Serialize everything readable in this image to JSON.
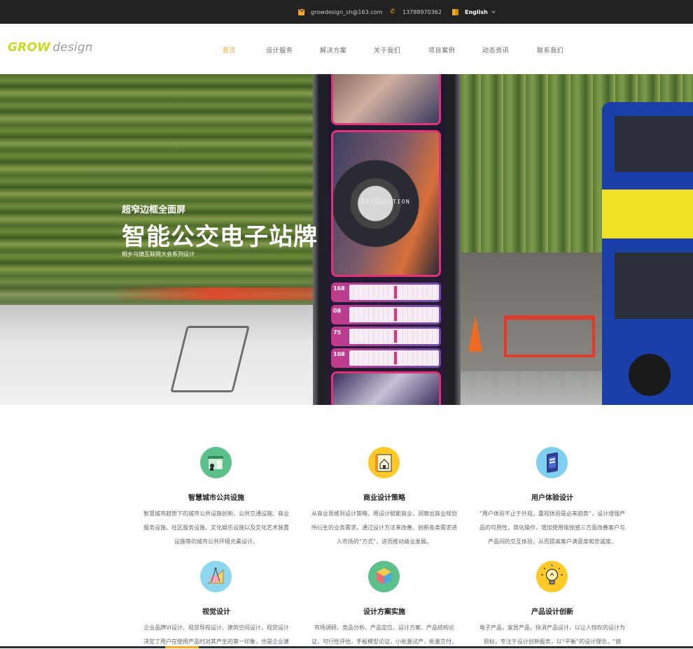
{
  "topbar": {
    "email": "growdesign_sh@163.com",
    "phone": "13788970362",
    "language": "English"
  },
  "header": {
    "logo_grow": "GROW",
    "logo_design": "design",
    "nav": [
      {
        "label": "首页",
        "active": true
      },
      {
        "label": "设计服务",
        "active": false
      },
      {
        "label": "解决方案",
        "active": false
      },
      {
        "label": "关于我们",
        "active": false
      },
      {
        "label": "项目案例",
        "active": false
      },
      {
        "label": "动态资讯",
        "active": false
      },
      {
        "label": "联系我们",
        "active": false
      }
    ]
  },
  "hero": {
    "subtitle": "超窄边框全面屏",
    "title": "智能公交电子站牌",
    "caption": "桐乡乌镇互联网大会系列设计",
    "poster_title": "DISSOLUTION",
    "routes": [
      "168",
      "08",
      "75",
      "108"
    ]
  },
  "services": [
    {
      "icon": "city-kiosk-icon",
      "icon_color": "#5cc08a",
      "title": "智慧城市公共设施",
      "lines": [
        "智慧城市趋势下的城市公共设施创新，公共交通设施、商业",
        "服务设施、社区服务设施、文化娱乐设施以及文化艺术装置",
        "设施等的城市公共环境元素设计。"
      ]
    },
    {
      "icon": "blueprint-house-icon",
      "icon_color": "#ffc928",
      "title": "商业设计策略",
      "lines": [
        "从商业思维到设计策略，用设计赋能商业，洞察出商业规划",
        "所衍生的业务需求，通过设计方法来改善、创新各类需求进",
        "入市场的“方式”，进而推动商业发展。"
      ]
    },
    {
      "icon": "mobile-device-icon",
      "icon_color": "#7fd0f0",
      "title": "用户体验设计",
      "lines": [
        "“用户体验不止于外观，重视体验是必来趋势”，设计增强产",
        "品的可用性，简化操作，增加使用愉悦感三方面改善客户与",
        "产品间的交互体验，从而提高客户满意度和忠诚度。"
      ]
    },
    {
      "icon": "compass-ruler-icon",
      "icon_color": "#8ed6f0",
      "title": "视觉设计",
      "lines": [
        "企业品牌VI设计、视觉导视设计、建筑空间设计，视觉设计",
        "决定了用户在使用产品时对其产生的第一印象，也是企业建"
      ]
    },
    {
      "icon": "cube-icon",
      "icon_color": "#5cc08a",
      "title": "设计方案实施",
      "lines": [
        "市场调研、竞品分析、产品定位、设计方案、产品结构论",
        "证，可行性评估，手板模型论证，小批量试产，批量交付，"
      ]
    },
    {
      "icon": "lightbulb-icon",
      "icon_color": "#ffc928",
      "title": "产品设计创新",
      "lines": [
        "电子产品，家居产品，快消产品设计，以让人惊叹的设计为",
        "目标，专注于设计创新服务，以“平衡”的设计理念，“换"
      ]
    }
  ]
}
